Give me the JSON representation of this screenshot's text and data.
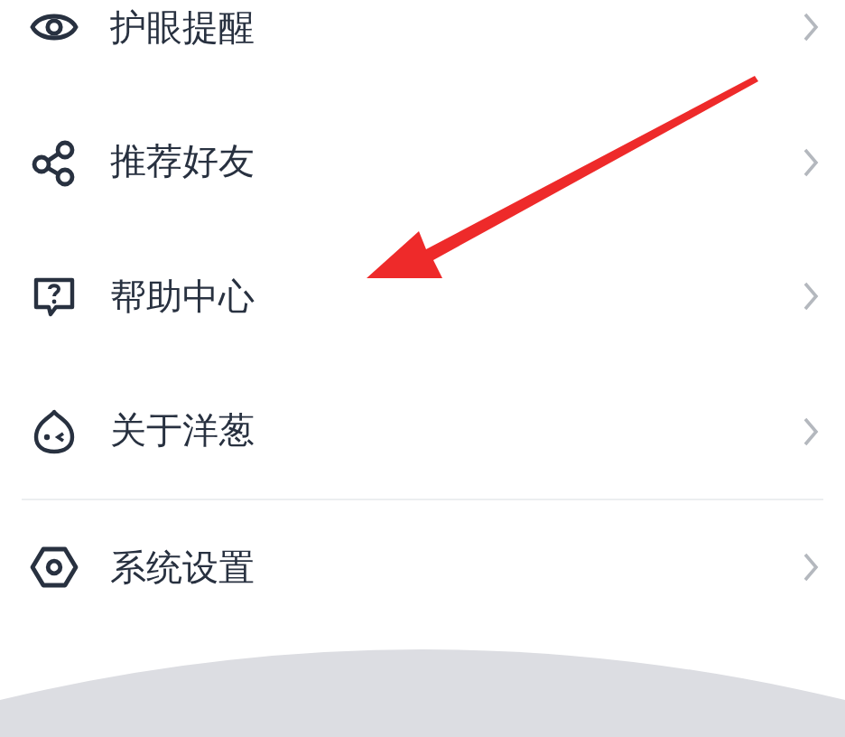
{
  "menu_items": [
    {
      "label": "护眼提醒"
    },
    {
      "label": "推荐好友"
    },
    {
      "label": "帮助中心"
    },
    {
      "label": "关于洋葱"
    }
  ],
  "settings_items": [
    {
      "label": "系统设置"
    }
  ]
}
